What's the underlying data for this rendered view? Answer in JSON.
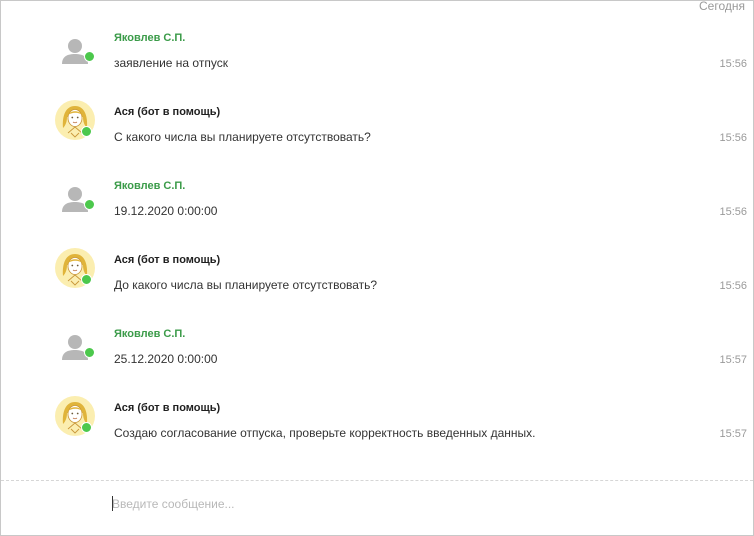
{
  "chat": {
    "date_label": "Сегодня",
    "messages": [
      {
        "author": "Яковлев С.П.",
        "role": "user",
        "text": "заявление на отпуск",
        "time": "15:56"
      },
      {
        "author": "Ася (бот в помощь)",
        "role": "bot",
        "text": "С какого числа вы планируете отсутствовать?",
        "time": "15:56"
      },
      {
        "author": "Яковлев С.П.",
        "role": "user",
        "text": "19.12.2020 0:00:00",
        "time": "15:56"
      },
      {
        "author": "Ася (бот в помощь)",
        "role": "bot",
        "text": "До какого числа вы планируете отсутствовать?",
        "time": "15:56"
      },
      {
        "author": "Яковлев С.П.",
        "role": "user",
        "text": "25.12.2020 0:00:00",
        "time": "15:57"
      },
      {
        "author": "Ася (бот в помощь)",
        "role": "bot",
        "text": "Создаю согласование отпуска, проверьте корректность введенных данных.",
        "time": "15:57"
      }
    ]
  },
  "composer": {
    "placeholder": "Введите сообщение..."
  },
  "colors": {
    "user_name": "#3b9b49",
    "online_status": "#4cc84c",
    "bot_avatar_bg": "#fbeeb0"
  },
  "icons": {
    "user_avatar": "person-silhouette-icon",
    "bot_avatar": "bot-girl-avatar-icon",
    "status": "online-status-dot"
  }
}
